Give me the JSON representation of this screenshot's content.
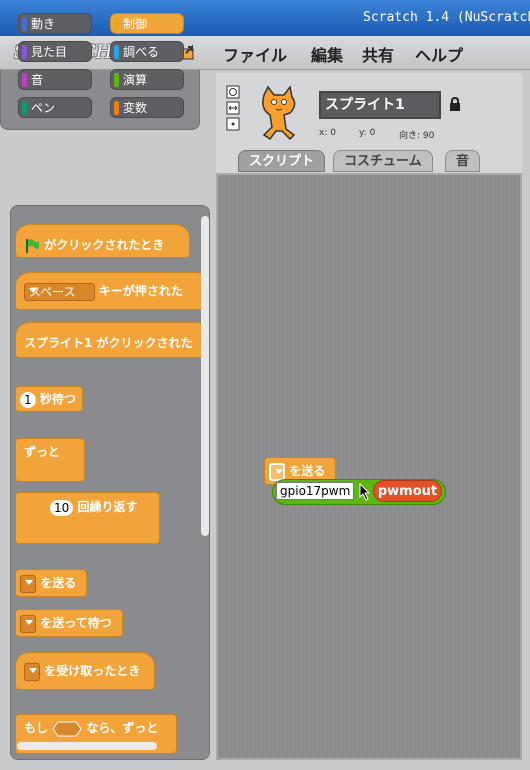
{
  "window": {
    "title": "Scratch 1.4 (NuScratch"
  },
  "menu": {
    "logo": "SCRATCH",
    "file": "ファイル",
    "edit": "編集",
    "share": "共有",
    "help": "ヘルプ"
  },
  "categories": [
    {
      "label": "動き",
      "color": "#4a6cd4"
    },
    {
      "label": "制御",
      "color": "#e1a91a"
    },
    {
      "label": "見た目",
      "color": "#8a55d7"
    },
    {
      "label": "調べる",
      "color": "#2ca5e2"
    },
    {
      "label": "音",
      "color": "#bb42c3"
    },
    {
      "label": "演算",
      "color": "#5cb712"
    },
    {
      "label": "ペン",
      "color": "#0e9a6c"
    },
    {
      "label": "変数",
      "color": "#ee7d16"
    }
  ],
  "palette": {
    "flag_clicked": "がクリックされたとき",
    "key_value": "スペース",
    "key_pressed": "キーが押された",
    "sprite_clicked": "スプライト1 がクリックされた",
    "wait_num": "1",
    "wait_label": "秒待つ",
    "forever": "ずっと",
    "repeat_num": "10",
    "repeat_label": "回繰り返す",
    "broadcast": "を送る",
    "broadcast_wait": "を送って待つ",
    "when_receive": "を受け取ったとき",
    "forever_if_pre": "もし",
    "forever_if_post": "なら、ずっと"
  },
  "sprite": {
    "name": "スプライト1",
    "x_label": "x: 0",
    "y_label": "y: 0",
    "dir_label": "向き: 90"
  },
  "tabs": {
    "scripts": "スクリプト",
    "costumes": "コスチューム",
    "sounds": "音"
  },
  "script": {
    "broadcast_label": "を送る",
    "text_input": "gpio17pwm",
    "reporter": "pwmout"
  },
  "colors": {
    "control": "#f2a33a",
    "operators": "#5cb712",
    "sensing_red": "#e2522a"
  }
}
